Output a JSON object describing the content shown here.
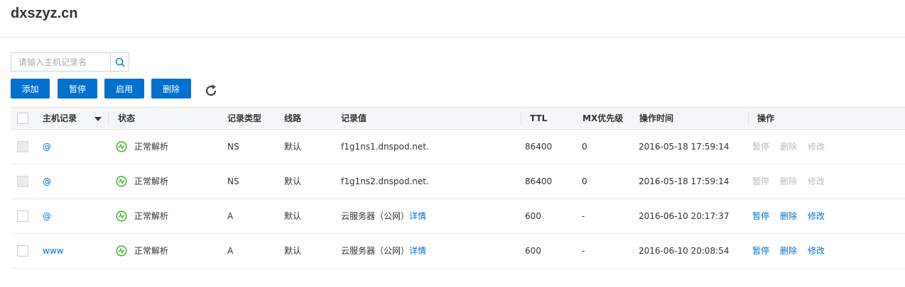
{
  "page": {
    "title": "dxszyz.cn"
  },
  "search": {
    "placeholder": "请输入主机记录名",
    "icon": "search-icon"
  },
  "toolbar": {
    "add_label": "添加",
    "pause_label": "暂停",
    "enable_label": "启用",
    "delete_label": "删除",
    "refresh_icon": "refresh-icon"
  },
  "colors": {
    "primary": "#0071ce",
    "status_ok": "#52b533",
    "disabled_text": "#bbbbbb"
  },
  "table": {
    "columns": {
      "host": "主机记录",
      "status": "状态",
      "type": "记录类型",
      "line": "线路",
      "value": "记录值",
      "ttl": "TTL",
      "mx": "MX优先级",
      "time": "操作时间",
      "ops": "操作"
    },
    "rows": [
      {
        "host": "@",
        "status": "正常解析",
        "type": "NS",
        "line": "默认",
        "value": "f1g1ns1.dnspod.net.",
        "value_link": "",
        "ttl": "86400",
        "mx": "0",
        "time": "2016-05-18 17:59:14",
        "op_pause": "暂停",
        "op_delete": "删除",
        "op_modify": "修改",
        "editable": false
      },
      {
        "host": "@",
        "status": "正常解析",
        "type": "NS",
        "line": "默认",
        "value": "f1g1ns2.dnspod.net.",
        "value_link": "",
        "ttl": "86400",
        "mx": "0",
        "time": "2016-05-18 17:59:14",
        "op_pause": "暂停",
        "op_delete": "删除",
        "op_modify": "修改",
        "editable": false
      },
      {
        "host": "@",
        "status": "正常解析",
        "type": "A",
        "line": "默认",
        "value": "云服务器（公网）",
        "value_link": "详情",
        "ttl": "600",
        "mx": "-",
        "time": "2016-06-10 20:17:37",
        "op_pause": "暂停",
        "op_delete": "删除",
        "op_modify": "修改",
        "editable": true
      },
      {
        "host": "www",
        "status": "正常解析",
        "type": "A",
        "line": "默认",
        "value": "云服务器（公网）",
        "value_link": "详情",
        "ttl": "600",
        "mx": "-",
        "time": "2016-06-10 20:08:54",
        "op_pause": "暂停",
        "op_delete": "删除",
        "op_modify": "修改",
        "editable": true
      }
    ]
  }
}
